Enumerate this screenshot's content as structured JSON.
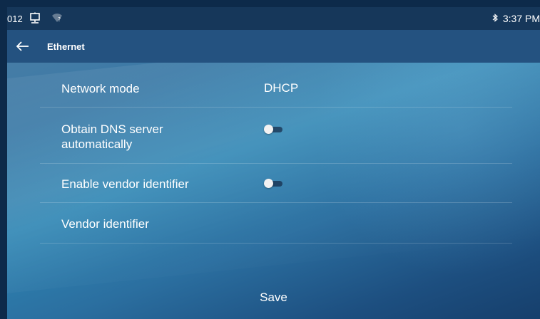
{
  "status_bar": {
    "code": "012",
    "time": "3:37 PM",
    "icons": [
      "computer-icon",
      "wifi-icon",
      "bluetooth-icon"
    ]
  },
  "app_bar": {
    "title": "Ethernet",
    "back_icon": "arrow-left-icon"
  },
  "settings": [
    {
      "label": "Network mode",
      "value": "DHCP"
    },
    {
      "label": "Obtain DNS server automatically",
      "toggle": "off"
    },
    {
      "label": "Enable vendor identifier",
      "toggle": "off"
    },
    {
      "label": "Vendor identifier",
      "value": ""
    }
  ],
  "save_label": "Save",
  "colors": {
    "status_bar": "#16375a",
    "app_bar": "#245280",
    "background_top": "#3a79a6",
    "background_bottom": "#163f6c"
  }
}
